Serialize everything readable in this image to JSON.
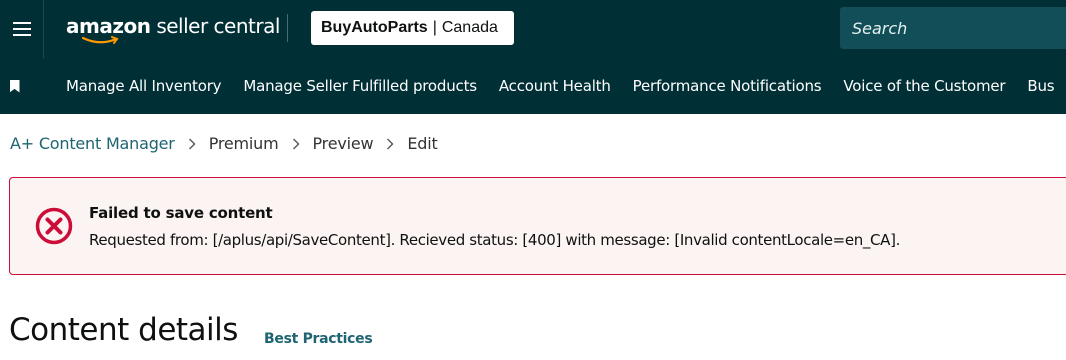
{
  "header": {
    "logo": {
      "brand": "amazon",
      "product": "seller central"
    },
    "store": {
      "name": "BuyAutoParts",
      "separator": "|",
      "region": "Canada"
    },
    "search": {
      "placeholder": "Search",
      "value": ""
    }
  },
  "nav": {
    "items": [
      {
        "label": "Manage All Inventory"
      },
      {
        "label": "Manage Seller Fulfilled products"
      },
      {
        "label": "Account Health"
      },
      {
        "label": "Performance Notifications"
      },
      {
        "label": "Voice of the Customer"
      },
      {
        "label": "Bus"
      }
    ]
  },
  "breadcrumb": {
    "root": "A+ Content Manager",
    "items": [
      "Premium",
      "Preview",
      "Edit"
    ]
  },
  "alert": {
    "title": "Failed to save content",
    "message": "Requested from: [/aplus/api/SaveContent]. Recieved status: [400] with message: [Invalid contentLocale=en_CA]."
  },
  "page": {
    "title": "Content details",
    "best_practices_label": "Best Practices"
  },
  "colors": {
    "header_bg": "#002f36",
    "search_bg": "#124e57",
    "link": "#1e6472",
    "alert_border": "#cc0c39",
    "alert_bg": "#fcf4f2"
  },
  "icons": {
    "menu": "hamburger-icon",
    "bookmark": "bookmark-icon",
    "breadcrumb_separator": "chevron-right-icon",
    "alert": "error-circle-x-icon"
  }
}
